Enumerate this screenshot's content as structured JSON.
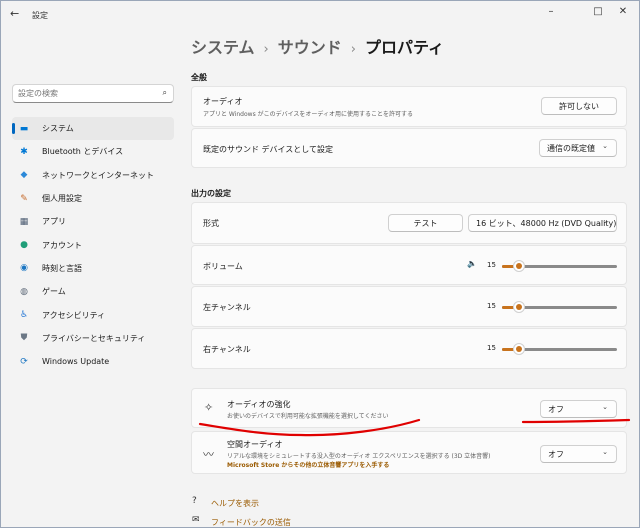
{
  "window": {
    "title": "設定",
    "back_glyph": "←",
    "minimize_glyph": "–",
    "maximize_glyph": "□",
    "close_glyph": "✕"
  },
  "breadcrumb": {
    "part1": "システム",
    "part2": "サウンド",
    "part3": "プロパティ",
    "separator": "›"
  },
  "search": {
    "placeholder": "設定の検索",
    "icon": "search-icon",
    "glyph": "⌕"
  },
  "sidebar": {
    "items": [
      {
        "label": "システム",
        "icon": "system-icon",
        "glyph": "▬",
        "color": "#0078d4",
        "active": true
      },
      {
        "label": "Bluetooth とデバイス",
        "icon": "bluetooth-icon",
        "glyph": "✱",
        "color": "#0078d4"
      },
      {
        "label": "ネットワークとインターネット",
        "icon": "network-icon",
        "glyph": "◆",
        "color": "#2b88d8"
      },
      {
        "label": "個人用設定",
        "icon": "pen-icon",
        "glyph": "✎",
        "color": "#c56a2b"
      },
      {
        "label": "アプリ",
        "icon": "apps-icon",
        "glyph": "▦",
        "color": "#4a5a70"
      },
      {
        "label": "アカウント",
        "icon": "account-icon",
        "glyph": "●",
        "color": "#1f9e78"
      },
      {
        "label": "時刻と言語",
        "icon": "globe-icon",
        "glyph": "◉",
        "color": "#1a75c2"
      },
      {
        "label": "ゲーム",
        "icon": "gamepad-icon",
        "glyph": "◍",
        "color": "#5f6b7a"
      },
      {
        "label": "アクセシビリティ",
        "icon": "accessibility-icon",
        "glyph": "♿",
        "color": "#2a7ad5"
      },
      {
        "label": "プライバシーとセキュリティ",
        "icon": "shield-icon",
        "glyph": "⛊",
        "color": "#6b7785"
      },
      {
        "label": "Windows Update",
        "icon": "update-icon",
        "glyph": "⟳",
        "color": "#1a75c2"
      }
    ]
  },
  "general": {
    "section_title": "全般",
    "audio_title": "オーディオ",
    "audio_sub": "アプリと Windows がこのデバイスをオーディオ用に使用することを許可する",
    "audio_button": "許可しない",
    "default_title": "既定のサウンド デバイスとして設定",
    "default_value": "通信の既定値"
  },
  "output": {
    "section_title": "出力の設定",
    "format_title": "形式",
    "test_button": "テスト",
    "format_value": "16 ビット、48000 Hz (DVD Quality)",
    "volume_title": "ボリューム",
    "volume_icon": "speaker-icon",
    "volume_glyph": "🔈",
    "volume_value": "15",
    "left_title": "左チャンネル",
    "left_value": "15",
    "right_title": "右チャンネル",
    "right_value": "15",
    "slider_level_percent": 15
  },
  "enhance": {
    "title": "オーディオの強化",
    "sub": "お使いのデバイスで利用可能な拡張機能を選択してください",
    "value": "オフ",
    "icon": "sparkle-icon",
    "glyph": "✧"
  },
  "spatial": {
    "title": "空間オーディオ",
    "sub": "リアルな環境をシミュレートする没入型のオーディオ エクスペリエンスを選択する (3D 立体音響)",
    "link": "Microsoft Store からその他の立体音響アプリを入手する",
    "value": "オフ",
    "icon": "waveform-icon",
    "glyph": "〰"
  },
  "footer": {
    "help_label": "ヘルプを表示",
    "help_icon": "help-icon",
    "help_glyph": "?",
    "feedback_label": "フィードバックの送信",
    "feedback_icon": "feedback-icon",
    "feedback_glyph": "✉"
  },
  "colors": {
    "accent": "#0067c0",
    "slider": "#c8731d",
    "annotation": "#e00000"
  }
}
